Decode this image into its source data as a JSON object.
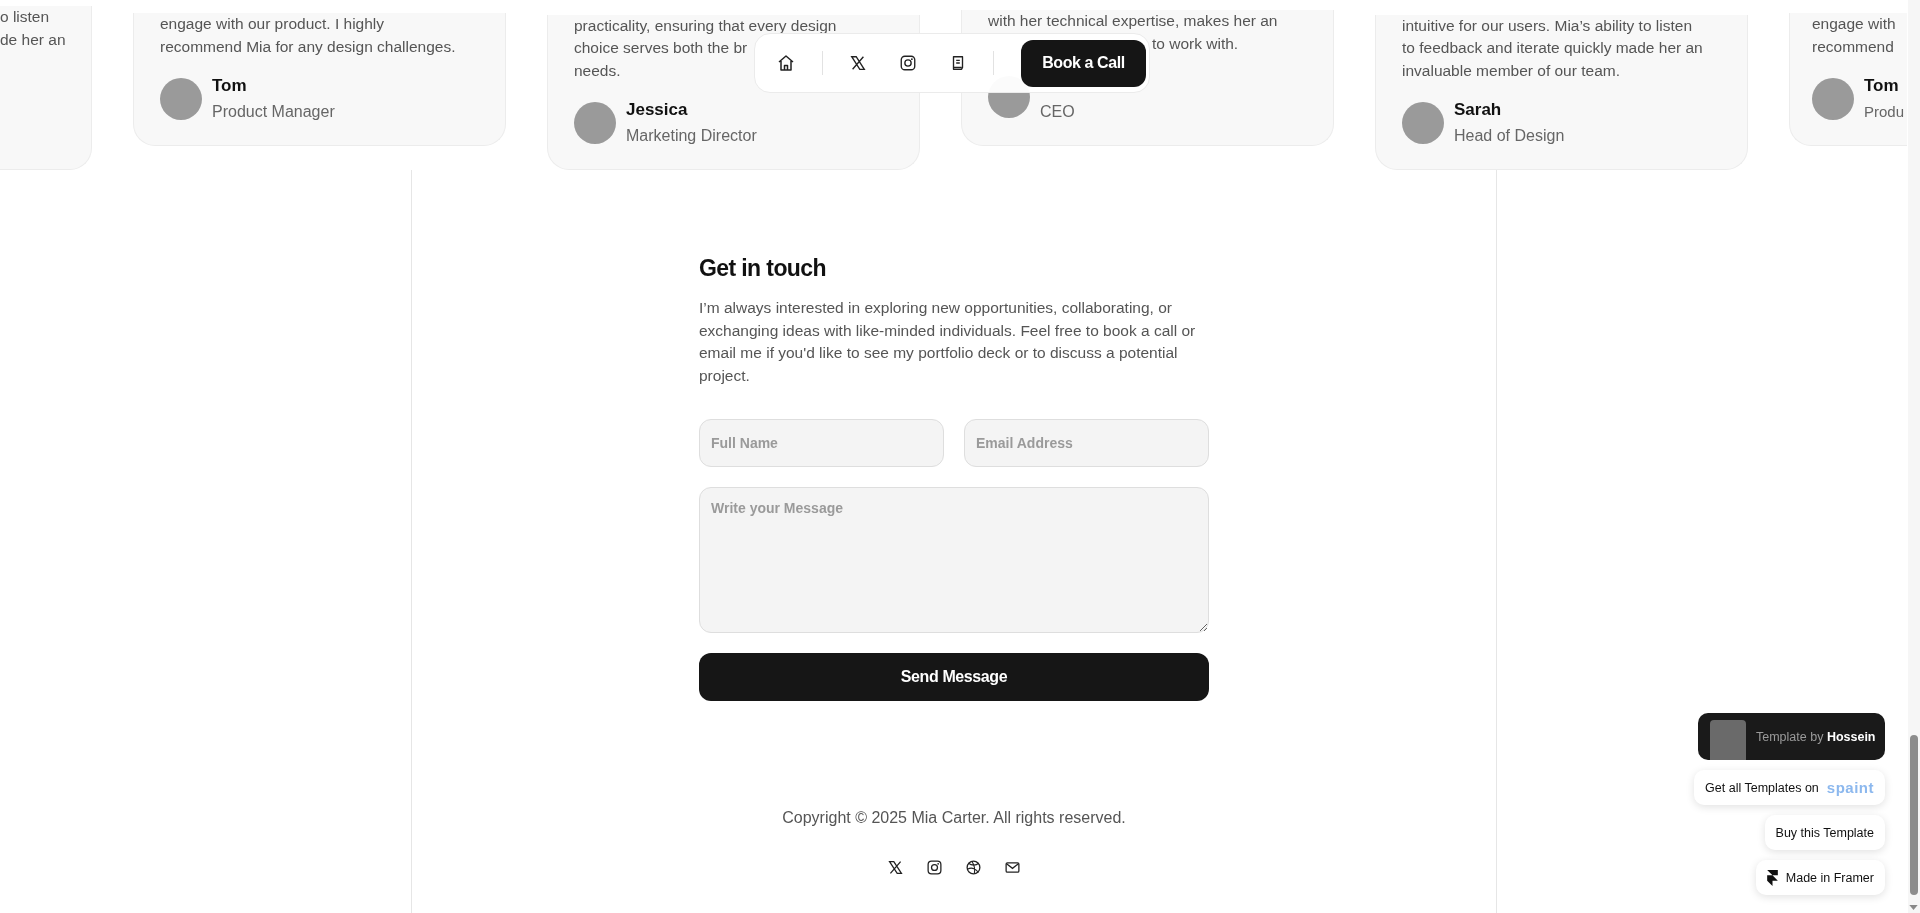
{
  "testimonials": [
    {
      "lines": [
        "o listen",
        "de her an"
      ]
    },
    {
      "lines": [
        "engage with our product. I highly",
        "recommend Mia for any design challenges."
      ],
      "name": "Tom",
      "role": "Product Manager"
    },
    {
      "lines": [
        "practicality, ensuring that every design",
        "choice serves both the br",
        "needs."
      ],
      "name": "Jessica",
      "role": "Marketing Director"
    },
    {
      "lines": [
        "with her technical expertise, makes her an",
        "to work with."
      ],
      "role": "CEO"
    },
    {
      "lines": [
        "intuitive for our users. Mia’s ability to listen",
        "to feedback and iterate quickly made her an",
        "invaluable member of our team."
      ],
      "name": "Sarah",
      "role": "Head of Design"
    },
    {
      "lines": [
        "engage with",
        "recommend"
      ],
      "name": "Tom",
      "role": "Produ"
    }
  ],
  "nav": {
    "button": "Book a Call"
  },
  "contact": {
    "title": "Get in touch",
    "text": "I’m always interested in exploring new opportunities, collaborating, or exchanging ideas with like-minded individuals. Feel free to book a call or email me if you'd like to see my portfolio deck or to discuss a potential project.",
    "fields": [
      {
        "placeholder": "Full Name"
      },
      {
        "placeholder": "Email Address"
      }
    ],
    "message": {
      "placeholder": "Write your Message"
    },
    "submit": "Send Message"
  },
  "footer": {
    "copyright": "Copyright © 2025 Mia Carter. All rights reserved."
  },
  "badges": {
    "author": "Template by **Hossein**",
    "templates": "Get all Templates on",
    "logo": "spaint",
    "buy": "Buy this Template",
    "framer": "Made in Framer"
  }
}
